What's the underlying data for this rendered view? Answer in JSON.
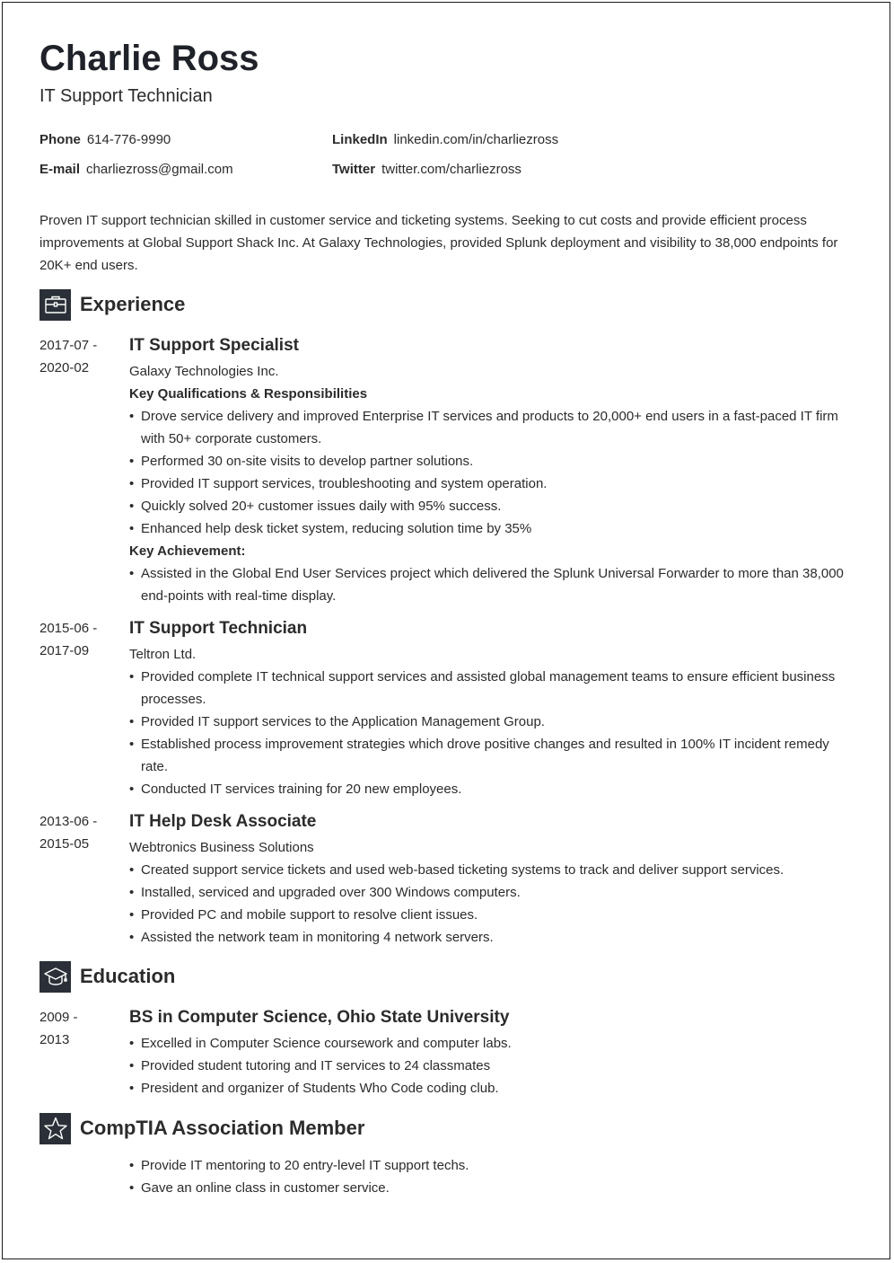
{
  "header": {
    "name": "Charlie Ross",
    "title": "IT Support Technician"
  },
  "contact": {
    "phone_label": "Phone",
    "phone": "614-776-9990",
    "email_label": "E-mail",
    "email": "charliezross@gmail.com",
    "linkedin_label": "LinkedIn",
    "linkedin": "linkedin.com/in/charliezross",
    "twitter_label": "Twitter",
    "twitter": "twitter.com/charliezross"
  },
  "summary": "Proven IT support technician skilled in customer service and ticketing systems. Seeking to cut costs and provide efficient process improvements at Global Support Shack Inc. At Galaxy Technologies, provided Splunk deployment and visibility to 38,000 endpoints for 20K+ end users.",
  "sections": {
    "experience": {
      "title": "Experience",
      "icon": "briefcase-icon"
    },
    "education": {
      "title": "Education",
      "icon": "graduation-cap-icon"
    },
    "membership": {
      "title": "CompTIA Association Member",
      "icon": "star-icon"
    }
  },
  "experience": [
    {
      "start": "2017-07 -",
      "end": "2020-02",
      "title": "IT Support Specialist",
      "company": "Galaxy Technologies Inc.",
      "subheading1": "Key Qualifications & Responsibilities",
      "bullets": [
        "Drove service delivery and improved Enterprise IT services and products to 20,000+ end users in a fast-paced IT firm with 50+ corporate customers.",
        "Performed 30 on-site visits to develop partner solutions.",
        "Provided IT support services, troubleshooting and system operation.",
        "Quickly solved 20+ customer issues daily with 95% success.",
        "Enhanced help desk ticket system, reducing solution time by 35%"
      ],
      "subheading2": "Key Achievement:",
      "achievements": [
        "Assisted in the Global End User Services project which delivered the Splunk Universal Forwarder to more than 38,000 end-points with real-time display."
      ]
    },
    {
      "start": "2015-06 -",
      "end": "2017-09",
      "title": "IT Support Technician",
      "company": "Teltron Ltd.",
      "bullets": [
        "Provided complete IT technical support services and assisted global management teams to ensure efficient business processes.",
        "Provided IT support services to the Application Management Group.",
        "Established process improvement strategies which drove positive changes and resulted in 100% IT incident remedy rate.",
        "Conducted IT services training for 20 new employees."
      ]
    },
    {
      "start": "2013-06 -",
      "end": "2015-05",
      "title": "IT Help Desk Associate",
      "company": "Webtronics Business Solutions",
      "bullets": [
        "Created support service tickets and used web-based ticketing systems to track and deliver support services.",
        "Installed, serviced and upgraded over 300 Windows computers.",
        "Provided PC and mobile support to resolve client issues.",
        "Assisted the network team in monitoring 4 network servers."
      ]
    }
  ],
  "education": [
    {
      "start": "2009 -",
      "end": "2013",
      "title": "BS in Computer Science, Ohio State University",
      "bullets": [
        "Excelled in Computer Science coursework and computer labs.",
        "Provided student tutoring and IT services to 24 classmates",
        "President and organizer of Students Who Code coding club."
      ]
    }
  ],
  "membership": {
    "bullets": [
      "Provide IT mentoring to 20 entry-level IT support techs.",
      "Gave an online class in customer service."
    ]
  }
}
